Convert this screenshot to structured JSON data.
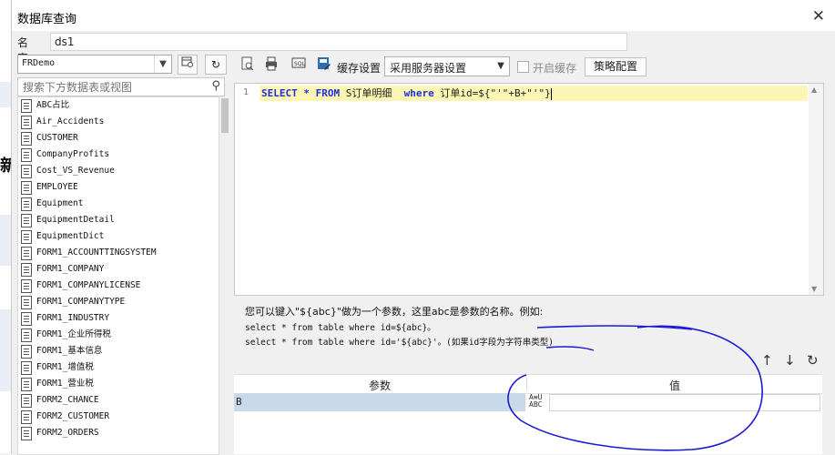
{
  "dialog": {
    "title": "数据库查询",
    "close_label": "✕"
  },
  "name": {
    "label": "名字:",
    "value": "ds1"
  },
  "left": {
    "database": "FRDemo",
    "search_placeholder": "搜索下方数据表或视图",
    "tables": [
      "ABC占比",
      "Air_Accidents",
      "CUSTOMER",
      "CompanyProfits",
      "Cost_VS_Revenue",
      "EMPLOYEE",
      "Equipment",
      "EquipmentDetail",
      "EquipmentDict",
      "FORM1_ACCOUNTTINGSYSTEM",
      "FORM1_COMPANY",
      "FORM1_COMPANYLICENSE",
      "FORM1_COMPANYTYPE",
      "FORM1_INDUSTRY",
      "FORM1_企业所得税",
      "FORM1_基本信息",
      "FORM1_增值税",
      "FORM1_营业税",
      "FORM2_CHANCE",
      "FORM2_CUSTOMER",
      "FORM2_ORDERS"
    ]
  },
  "toolbar": {
    "cache_label": "缓存设置",
    "cache_select": "采用服务器设置",
    "enable_cache_label": "开启缓存",
    "strategy_button": "策略配置"
  },
  "editor": {
    "line_number": "1",
    "tokens": {
      "select": "SELECT",
      "star": " * ",
      "from": "FROM",
      "table": " S订单明细  ",
      "where": "where",
      "cond": " 订单id=${\"'\"+B+\"'\"}"
    }
  },
  "hint": {
    "line1": "您可以键入\"${abc}\"做为一个参数，这里abc是参数的名称。例如:",
    "line2": "select * from table where id=${abc}。",
    "line3": "select * from table where id='${abc}'。(如果id字段为字符串类型)"
  },
  "params": {
    "col_param": "参数",
    "col_value": "值",
    "rows": [
      {
        "name": "B",
        "type_line1": "A≡U",
        "type_line2": "ABC",
        "value": ""
      }
    ]
  },
  "icons": {
    "close": "close-icon",
    "dropdown": "chevron-down-icon",
    "search": "search-icon",
    "refresh": "refresh-icon",
    "up": "arrow-up-icon",
    "down": "arrow-down-icon"
  },
  "colors": {
    "sql_keyword": "#1f2fd8",
    "editor_highlight": "#fbf6b4",
    "selected_row": "#c8d9ea",
    "annotation_ink": "#1a1ad4"
  }
}
